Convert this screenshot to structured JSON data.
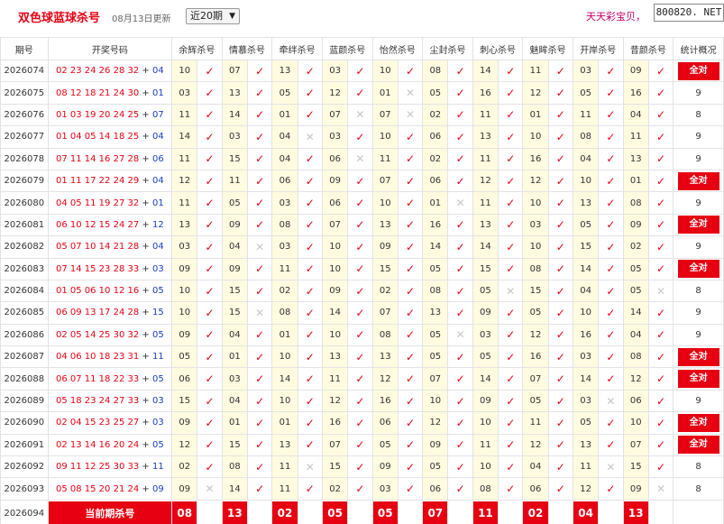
{
  "header": {
    "title": "双色球蓝球杀号",
    "updated": "08月13日更新",
    "period_select": "近20期",
    "promo": "天天彩宝贝，",
    "site_badge": "800820. NET"
  },
  "columns": {
    "period": "期号",
    "draw": "开奖号码",
    "experts": [
      "余辉杀号",
      "情慕杀号",
      "牵绊杀号",
      "蓝颜杀号",
      "怡然杀号",
      "尘封杀号",
      "刺心杀号",
      "魅眸杀号",
      "开岸杀号",
      "昔颜杀号"
    ],
    "stat": "统计概况"
  },
  "colors": {
    "accent_red": "#e60012",
    "blue_ball": "#1a3cbd",
    "kill_cell_bg": "#fffbe0",
    "miss_mark": "#c8c8c8"
  },
  "rows": [
    {
      "period": "2026074",
      "reds": "02 23 24 26 28 32",
      "blue": "04",
      "kills": [
        "10",
        "07",
        "13",
        "03",
        "10",
        "08",
        "14",
        "11",
        "03",
        "09"
      ],
      "marks": [
        "✓",
        "✓",
        "✓",
        "✓",
        "✓",
        "✓",
        "✓",
        "✓",
        "✓",
        "✓"
      ],
      "stat": "全对",
      "all": true
    },
    {
      "period": "2026075",
      "reds": "08 12 18 21 24 30",
      "blue": "01",
      "kills": [
        "03",
        "13",
        "05",
        "12",
        "01",
        "05",
        "16",
        "12",
        "05",
        "16"
      ],
      "marks": [
        "✓",
        "✓",
        "✓",
        "✓",
        "✕",
        "✓",
        "✓",
        "✓",
        "✓",
        "✓"
      ],
      "stat": "9",
      "all": false
    },
    {
      "period": "2026076",
      "reds": "01 03 19 20 24 25",
      "blue": "07",
      "kills": [
        "11",
        "14",
        "01",
        "07",
        "07",
        "02",
        "11",
        "01",
        "11",
        "04"
      ],
      "marks": [
        "✓",
        "✓",
        "✓",
        "✕",
        "✕",
        "✓",
        "✓",
        "✓",
        "✓",
        "✓"
      ],
      "stat": "8",
      "all": false
    },
    {
      "period": "2026077",
      "reds": "01 04 05 14 18 25",
      "blue": "04",
      "kills": [
        "14",
        "03",
        "04",
        "03",
        "10",
        "06",
        "13",
        "10",
        "08",
        "11"
      ],
      "marks": [
        "✓",
        "✓",
        "✕",
        "✓",
        "✓",
        "✓",
        "✓",
        "✓",
        "✓",
        "✓"
      ],
      "stat": "9",
      "all": false
    },
    {
      "period": "2026078",
      "reds": "07 11 14 16 27 28",
      "blue": "06",
      "kills": [
        "11",
        "15",
        "04",
        "06",
        "11",
        "02",
        "11",
        "16",
        "04",
        "13"
      ],
      "marks": [
        "✓",
        "✓",
        "✓",
        "✕",
        "✓",
        "✓",
        "✓",
        "✓",
        "✓",
        "✓"
      ],
      "stat": "9",
      "all": false
    },
    {
      "period": "2026079",
      "reds": "01 11 17 22 24 29",
      "blue": "04",
      "kills": [
        "12",
        "11",
        "06",
        "09",
        "07",
        "06",
        "12",
        "12",
        "10",
        "01"
      ],
      "marks": [
        "✓",
        "✓",
        "✓",
        "✓",
        "✓",
        "✓",
        "✓",
        "✓",
        "✓",
        "✓"
      ],
      "stat": "全对",
      "all": true
    },
    {
      "period": "2026080",
      "reds": "04 05 11 19 27 32",
      "blue": "01",
      "kills": [
        "11",
        "05",
        "03",
        "06",
        "10",
        "01",
        "11",
        "10",
        "13",
        "08"
      ],
      "marks": [
        "✓",
        "✓",
        "✓",
        "✓",
        "✓",
        "✕",
        "✓",
        "✓",
        "✓",
        "✓"
      ],
      "stat": "9",
      "all": false
    },
    {
      "period": "2026081",
      "reds": "06 10 12 15 24 27",
      "blue": "12",
      "kills": [
        "13",
        "09",
        "08",
        "07",
        "13",
        "16",
        "13",
        "03",
        "05",
        "09"
      ],
      "marks": [
        "✓",
        "✓",
        "✓",
        "✓",
        "✓",
        "✓",
        "✓",
        "✓",
        "✓",
        "✓"
      ],
      "stat": "全对",
      "all": true
    },
    {
      "period": "2026082",
      "reds": "05 07 10 14 21 28",
      "blue": "04",
      "kills": [
        "03",
        "04",
        "03",
        "10",
        "09",
        "14",
        "14",
        "10",
        "15",
        "02"
      ],
      "marks": [
        "✓",
        "✕",
        "✓",
        "✓",
        "✓",
        "✓",
        "✓",
        "✓",
        "✓",
        "✓"
      ],
      "stat": "9",
      "all": false
    },
    {
      "period": "2026083",
      "reds": "07 14 15 23 28 33",
      "blue": "03",
      "kills": [
        "09",
        "09",
        "11",
        "10",
        "15",
        "05",
        "15",
        "08",
        "14",
        "05"
      ],
      "marks": [
        "✓",
        "✓",
        "✓",
        "✓",
        "✓",
        "✓",
        "✓",
        "✓",
        "✓",
        "✓"
      ],
      "stat": "全对",
      "all": true
    },
    {
      "period": "2026084",
      "reds": "01 05 06 10 12 16",
      "blue": "05",
      "kills": [
        "10",
        "15",
        "02",
        "09",
        "02",
        "08",
        "05",
        "15",
        "04",
        "05"
      ],
      "marks": [
        "✓",
        "✓",
        "✓",
        "✓",
        "✓",
        "✓",
        "✕",
        "✓",
        "✓",
        "✕"
      ],
      "stat": "8",
      "all": false
    },
    {
      "period": "2026085",
      "reds": "06 09 13 17 24 28",
      "blue": "15",
      "kills": [
        "10",
        "15",
        "08",
        "14",
        "07",
        "13",
        "09",
        "05",
        "10",
        "14"
      ],
      "marks": [
        "✓",
        "✕",
        "✓",
        "✓",
        "✓",
        "✓",
        "✓",
        "✓",
        "✓",
        "✓"
      ],
      "stat": "9",
      "all": false
    },
    {
      "period": "2026086",
      "reds": "02 05 14 25 30 32",
      "blue": "05",
      "kills": [
        "09",
        "04",
        "01",
        "10",
        "08",
        "05",
        "03",
        "12",
        "16",
        "04"
      ],
      "marks": [
        "✓",
        "✓",
        "✓",
        "✓",
        "✓",
        "✕",
        "✓",
        "✓",
        "✓",
        "✓"
      ],
      "stat": "9",
      "all": false
    },
    {
      "period": "2026087",
      "reds": "04 06 10 18 23 31",
      "blue": "11",
      "kills": [
        "05",
        "01",
        "10",
        "13",
        "13",
        "05",
        "05",
        "16",
        "03",
        "08"
      ],
      "marks": [
        "✓",
        "✓",
        "✓",
        "✓",
        "✓",
        "✓",
        "✓",
        "✓",
        "✓",
        "✓"
      ],
      "stat": "全对",
      "all": true
    },
    {
      "period": "2026088",
      "reds": "06 07 11 18 22 33",
      "blue": "05",
      "kills": [
        "06",
        "03",
        "14",
        "11",
        "12",
        "07",
        "14",
        "07",
        "14",
        "12"
      ],
      "marks": [
        "✓",
        "✓",
        "✓",
        "✓",
        "✓",
        "✓",
        "✓",
        "✓",
        "✓",
        "✓"
      ],
      "stat": "全对",
      "all": true
    },
    {
      "period": "2026089",
      "reds": "05 18 23 24 27 33",
      "blue": "03",
      "kills": [
        "15",
        "04",
        "10",
        "12",
        "16",
        "10",
        "09",
        "05",
        "03",
        "06"
      ],
      "marks": [
        "✓",
        "✓",
        "✓",
        "✓",
        "✓",
        "✓",
        "✓",
        "✓",
        "✕",
        "✓"
      ],
      "stat": "9",
      "all": false
    },
    {
      "period": "2026090",
      "reds": "02 04 15 23 25 27",
      "blue": "03",
      "kills": [
        "09",
        "01",
        "01",
        "16",
        "06",
        "12",
        "10",
        "11",
        "05",
        "10"
      ],
      "marks": [
        "✓",
        "✓",
        "✓",
        "✓",
        "✓",
        "✓",
        "✓",
        "✓",
        "✓",
        "✓"
      ],
      "stat": "全对",
      "all": true
    },
    {
      "period": "2026091",
      "reds": "02 13 14 16 20 24",
      "blue": "05",
      "kills": [
        "12",
        "15",
        "13",
        "07",
        "05",
        "09",
        "11",
        "12",
        "13",
        "07"
      ],
      "marks": [
        "✓",
        "✓",
        "✓",
        "✓",
        "✓",
        "✓",
        "✓",
        "✓",
        "✓",
        "✓"
      ],
      "stat": "全对",
      "all": true
    },
    {
      "period": "2026092",
      "reds": "09 11 12 25 30 33",
      "blue": "11",
      "kills": [
        "02",
        "08",
        "11",
        "15",
        "09",
        "05",
        "10",
        "04",
        "11",
        "15"
      ],
      "marks": [
        "✓",
        "✓",
        "✕",
        "✓",
        "✓",
        "✓",
        "✓",
        "✓",
        "✕",
        "✓"
      ],
      "stat": "8",
      "all": false
    },
    {
      "period": "2026093",
      "reds": "05 08 15 20 21 24",
      "blue": "09",
      "kills": [
        "09",
        "14",
        "11",
        "02",
        "03",
        "06",
        "08",
        "06",
        "12",
        "09"
      ],
      "marks": [
        "✕",
        "✓",
        "✓",
        "✓",
        "✓",
        "✓",
        "✓",
        "✓",
        "✓",
        "✕"
      ],
      "stat": "8",
      "all": false
    }
  ],
  "current": {
    "period": "2026094",
    "label": "当前期杀号",
    "kills": [
      "08",
      "13",
      "02",
      "05",
      "05",
      "07",
      "11",
      "02",
      "04",
      "13"
    ]
  }
}
